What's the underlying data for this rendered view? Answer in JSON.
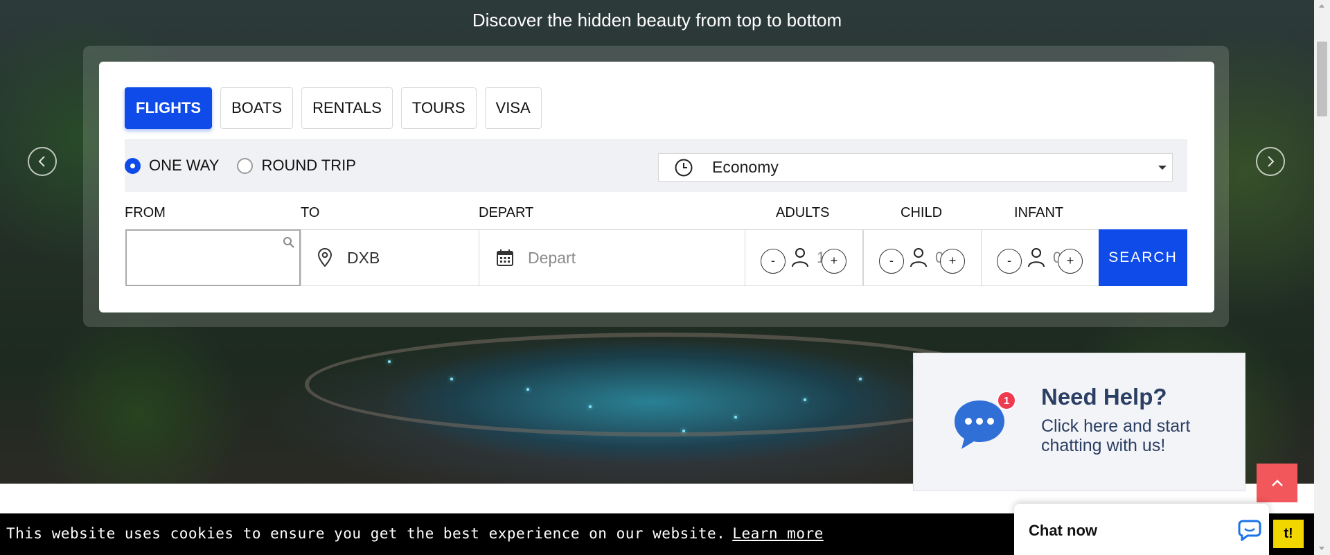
{
  "hero": {
    "tagline": "Discover the hidden beauty from top to bottom"
  },
  "carousel": {
    "prev_icon": "chevron-left-icon",
    "next_icon": "chevron-right-icon"
  },
  "search_widget": {
    "tabs": [
      {
        "label": "FLIGHTS",
        "active": true
      },
      {
        "label": "BOATS",
        "active": false
      },
      {
        "label": "RENTALS",
        "active": false
      },
      {
        "label": "TOURS",
        "active": false
      },
      {
        "label": "VISA",
        "active": false
      }
    ],
    "trip_types": [
      {
        "label": "ONE WAY",
        "checked": true
      },
      {
        "label": "ROUND TRIP",
        "checked": false
      }
    ],
    "cabin_class": {
      "icon": "clock-icon",
      "value": "Economy"
    },
    "labels": {
      "from": "FROM",
      "to": "TO",
      "depart": "DEPART",
      "adults": "ADULTS",
      "child": "CHILD",
      "infant": "INFANT"
    },
    "from_value": "",
    "to_value": "DXB",
    "depart_placeholder": "Depart",
    "counters": {
      "adults": "1",
      "child": "0",
      "infant": "0",
      "minus": "-",
      "plus": "+"
    },
    "search_label": "SEARCH"
  },
  "help_widget": {
    "badge": "1",
    "title": "Need Help?",
    "subtitle": "Click here and start chatting with us!"
  },
  "cookie_bar": {
    "message": "This website uses cookies to ensure you get the best experience on our website.",
    "learn_more": "Learn more",
    "button": "t!"
  },
  "chat_widget": {
    "label": "Chat now"
  },
  "colors": {
    "primary": "#0f4be8",
    "help_text": "#2b3e63",
    "to_top": "#f1575b",
    "cookie_button": "#f1d600"
  }
}
